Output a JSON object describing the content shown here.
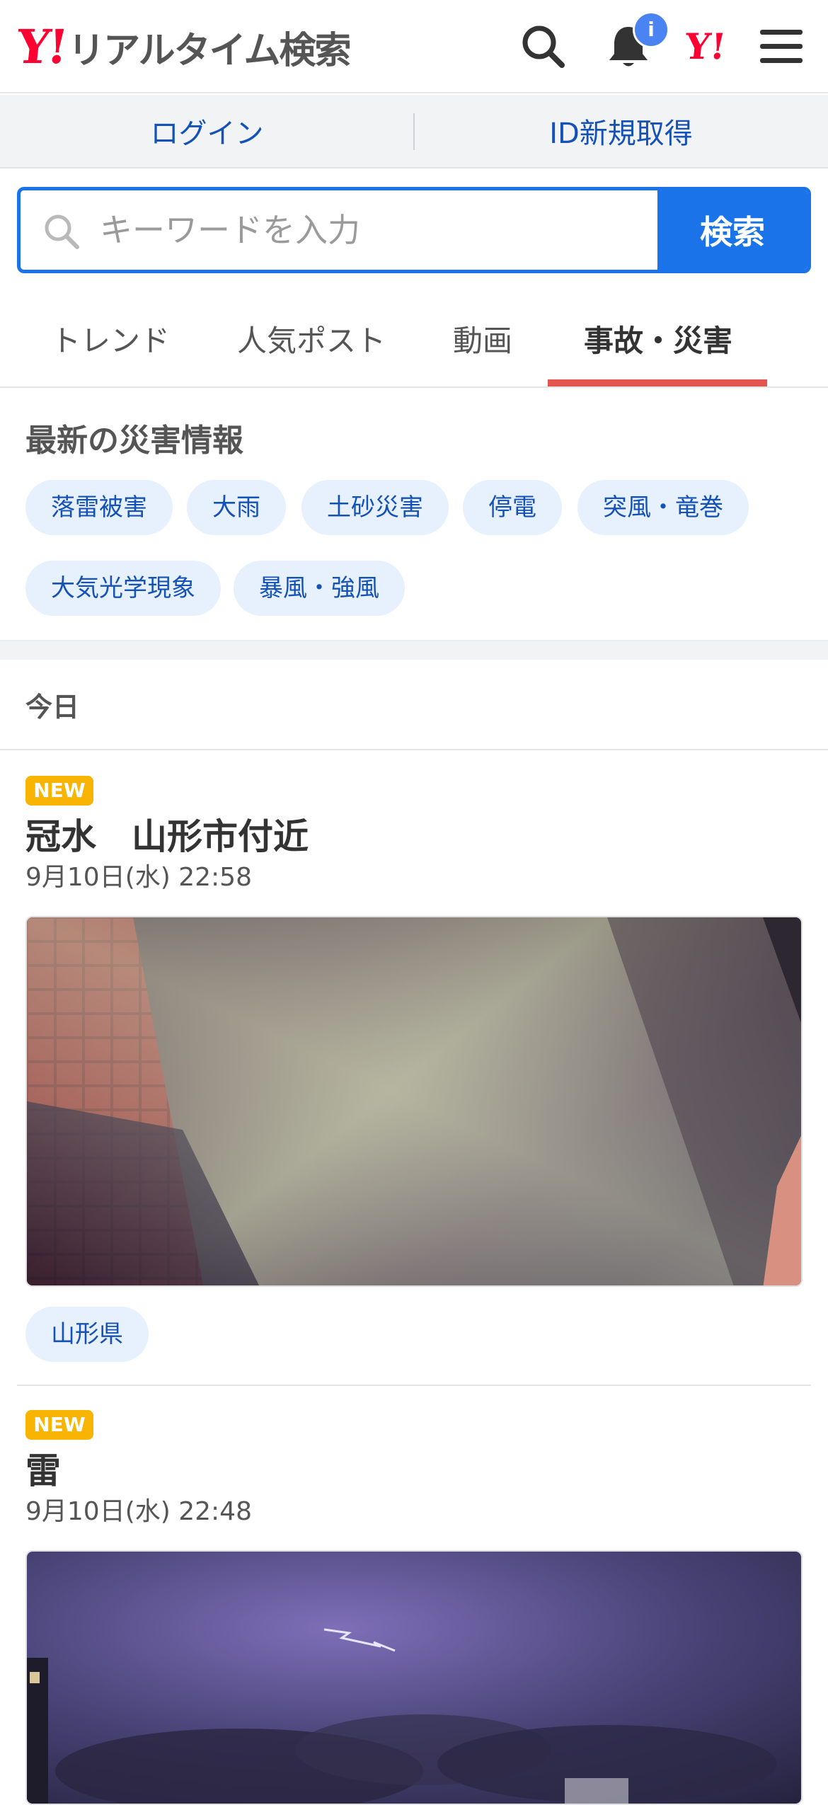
{
  "header": {
    "logo_mark": "Y!",
    "logo_text": "リアルタイム検索",
    "notification_badge": "i",
    "yahoo_mark": "Y!"
  },
  "auth": {
    "login_label": "ログイン",
    "register_label": "ID新規取得"
  },
  "search": {
    "placeholder": "キーワードを入力",
    "button_label": "検索"
  },
  "tabs": [
    {
      "label": "トレンド"
    },
    {
      "label": "人気ポスト"
    },
    {
      "label": "動画"
    },
    {
      "label": "事故・災害"
    }
  ],
  "active_tab": "事故・災害",
  "disaster_section": {
    "title": "最新の災害情報",
    "chips": [
      "落雷被害",
      "大雨",
      "土砂災害",
      "停電",
      "突風・竜巻",
      "大気光学現象",
      "暴風・強風"
    ]
  },
  "day_label": "今日",
  "posts": [
    {
      "badge": "NEW",
      "title": "冠水　山形市付近",
      "time": "9月10日(水) 22:58",
      "tag": "山形県"
    },
    {
      "badge": "NEW",
      "title": "雷",
      "time": "9月10日(水) 22:48"
    }
  ],
  "colors": {
    "accent": "#1a73e8",
    "brand_red": "#ff0033",
    "tab_underline": "#e4554f",
    "new_badge": "#f8b400",
    "chip_bg": "#e7f0fd",
    "link_blue": "#1552b8"
  },
  "icons": {
    "search": "search-icon",
    "bell": "bell-icon",
    "menu": "hamburger-menu-icon"
  }
}
